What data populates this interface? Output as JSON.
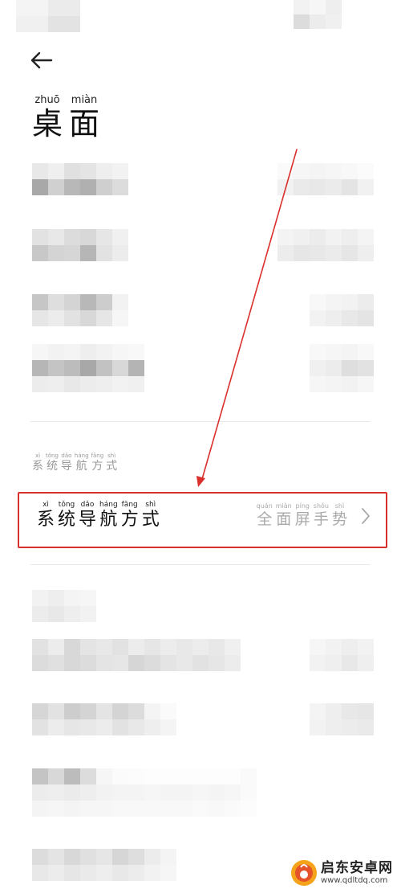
{
  "header": {
    "title": {
      "chars": [
        {
          "py": "zhuō",
          "hz": "桌"
        },
        {
          "py": "miàn",
          "hz": "面"
        }
      ]
    }
  },
  "section": {
    "label": [
      {
        "py": "xì",
        "hz": "系"
      },
      {
        "py": "tǒng",
        "hz": "统"
      },
      {
        "py": "dǎo",
        "hz": "导"
      },
      {
        "py": "háng",
        "hz": "航"
      },
      {
        "py": "fāng",
        "hz": "方"
      },
      {
        "py": "shì",
        "hz": "式"
      }
    ]
  },
  "nav_setting": {
    "label": [
      {
        "py": "xì",
        "hz": "系"
      },
      {
        "py": "tǒng",
        "hz": "统"
      },
      {
        "py": "dǎo",
        "hz": "导"
      },
      {
        "py": "háng",
        "hz": "航"
      },
      {
        "py": "fāng",
        "hz": "方"
      },
      {
        "py": "shì",
        "hz": "式"
      }
    ],
    "value": [
      {
        "py": "quán",
        "hz": "全"
      },
      {
        "py": "miàn",
        "hz": "面"
      },
      {
        "py": "píng",
        "hz": "屏"
      },
      {
        "py": "shǒu",
        "hz": "手"
      },
      {
        "py": "shì",
        "hz": "势"
      }
    ]
  },
  "watermark": {
    "name": "启东安卓网",
    "url": "www.qdltdq.com"
  },
  "colors": {
    "highlight": "#d9302c",
    "arrow": "#d9302c",
    "secondary_text": "#aaaaaa"
  }
}
